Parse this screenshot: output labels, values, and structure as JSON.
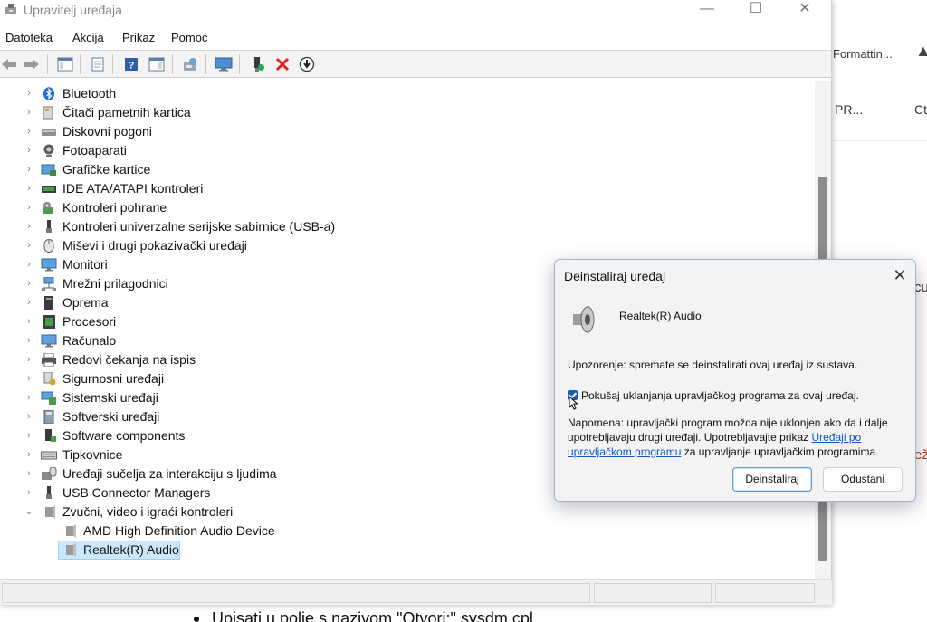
{
  "window": {
    "title": "Upravitelj uređaja",
    "controls": {
      "minimize": "—",
      "maximize": "☐",
      "close": "✕"
    }
  },
  "menu": [
    "Datoteka",
    "Akcija",
    "Prikaz",
    "Pomoć"
  ],
  "toolbar": [
    "back-arrow-icon",
    "forward-arrow-icon",
    "show-hide-console-tree-icon",
    "properties-icon",
    "help-icon",
    "action-pane-icon",
    "update-driver-icon",
    "scan-hardware-icon",
    "enable-device-icon",
    "uninstall-device-icon",
    "disable-device-icon"
  ],
  "tree": {
    "categories": [
      "Bluetooth",
      "Čitači pametnih kartica",
      "Diskovni pogoni",
      "Fotoaparati",
      "Grafičke kartice",
      "IDE ATA/ATAPI kontroleri",
      "Kontroleri pohrane",
      "Kontroleri univerzalne serijske sabirnice (USB-a)",
      "Miševi i drugi pokazivački uređaji",
      "Monitori",
      "Mrežni prilagodnici",
      "Oprema",
      "Procesori",
      "Računalo",
      "Redovi čekanja na ispis",
      "Sigurnosni uređaji",
      "Sistemski uređaji",
      "Softverski uređaji",
      "Software components",
      "Tipkovnice",
      "Uređaji sučelja za interakciju s ljudima",
      "USB Connector Managers",
      "Zvučni, video i igraći kontroleri"
    ],
    "expanded_children": [
      "AMD High Definition Audio Device",
      "Realtek(R) Audio"
    ],
    "selected": "Realtek(R) Audio"
  },
  "dialog": {
    "title": "Deinstaliraj uređaj",
    "close": "✕",
    "device_name": "Realtek(R) Audio",
    "warning": "Upozorenje: spremate se deinstalirati ovaj uređaj iz sustava.",
    "checkbox_label": "Pokušaj uklanjanja upravljačkog programa za ovaj uređaj.",
    "checkbox_checked": true,
    "note_before_link": "Napomena: upravljački program možda nije uklonjen ako da i dalje upotrebljavaju drugi uređaji. Upotrebljavajte prikaz ",
    "note_link": "Uređaji po upravljačkom programu",
    "note_after_link": " za upravljanje upravljačkim programima.",
    "uninstall_button": "Deinstaliraj",
    "cancel_button": "Odustani"
  },
  "background": {
    "tab_text": "Formattin...",
    "col1": "PR...",
    "col2": "Ct",
    "fragment1": "cu",
    "fragment2": "ež",
    "bullet_text": "Upisati u polje s nazivom \"Otvori:\" sysdm.cpl"
  }
}
